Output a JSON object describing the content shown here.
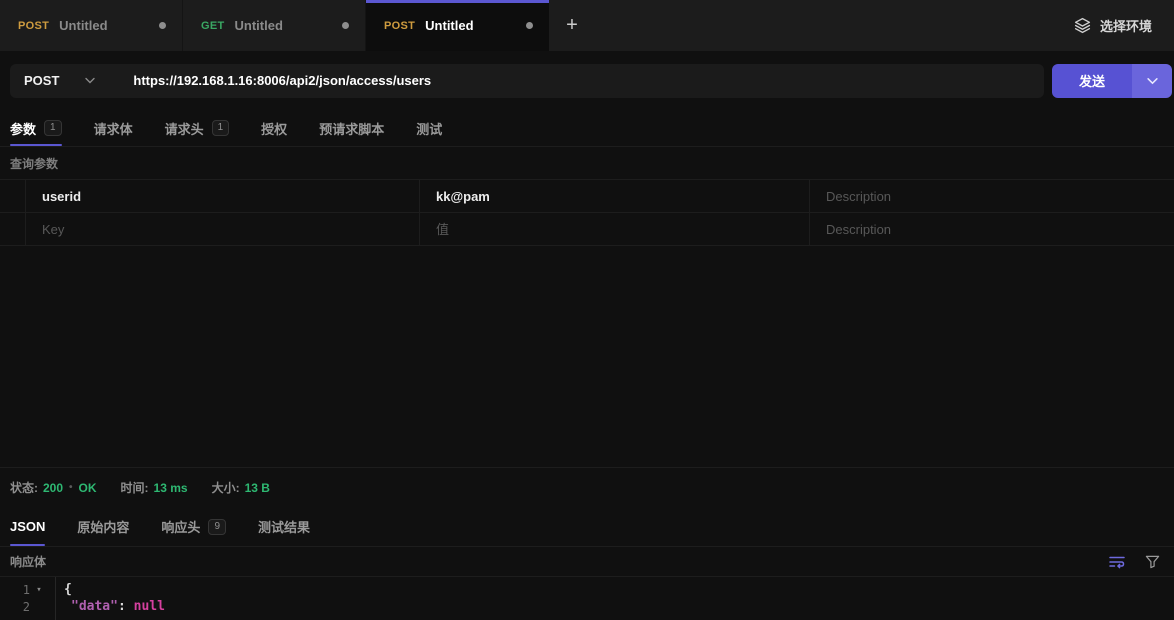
{
  "colors": {
    "accent": "#5b57d1",
    "send_button": "#5752d3",
    "status_green": "#2eb872",
    "method_post": "#cf9c3f",
    "method_get": "#3aa763",
    "json_key": "#b060b0",
    "json_null": "#d6409f"
  },
  "header": {
    "tabs": [
      {
        "method": "POST",
        "label": "Untitled",
        "modified": true
      },
      {
        "method": "GET",
        "label": "Untitled",
        "modified": true
      },
      {
        "method": "POST",
        "label": "Untitled",
        "modified": true
      }
    ],
    "new_tab_label": "+",
    "environment_label": "选择环境"
  },
  "request": {
    "method": "POST",
    "url": "https://192.168.1.16:8006/api2/json/access/users",
    "send_label": "发送",
    "tabs": [
      {
        "label": "参数",
        "badge": "1"
      },
      {
        "label": "请求体"
      },
      {
        "label": "请求头",
        "badge": "1"
      },
      {
        "label": "授权"
      },
      {
        "label": "预请求脚本"
      },
      {
        "label": "测试"
      }
    ],
    "query_params_label": "查询参数",
    "params_table": {
      "rows": [
        {
          "key": "userid",
          "value": "kk@pam",
          "description": "",
          "key_placeholder": "Key",
          "value_placeholder": "值",
          "description_placeholder": "Description"
        },
        {
          "key": "",
          "value": "",
          "description": "",
          "key_placeholder": "Key",
          "value_placeholder": "值",
          "description_placeholder": "Description"
        }
      ]
    }
  },
  "response": {
    "status_label": "状态:",
    "status_code": "200",
    "status_separator": "•",
    "status_text": "OK",
    "time_label": "时间:",
    "time_value": "13 ms",
    "size_label": "大小:",
    "size_value": "13 B",
    "tabs": [
      {
        "label": "JSON"
      },
      {
        "label": "原始内容"
      },
      {
        "label": "响应头",
        "badge": "9"
      },
      {
        "label": "测试结果"
      }
    ],
    "body_label": "响应体",
    "code": {
      "line1_num": "1",
      "fold_glyph": "▾",
      "line2_num": "2",
      "line1_brace": "{",
      "line2_key": "\"data\"",
      "line2_colon": ": ",
      "line2_value": "null"
    }
  }
}
